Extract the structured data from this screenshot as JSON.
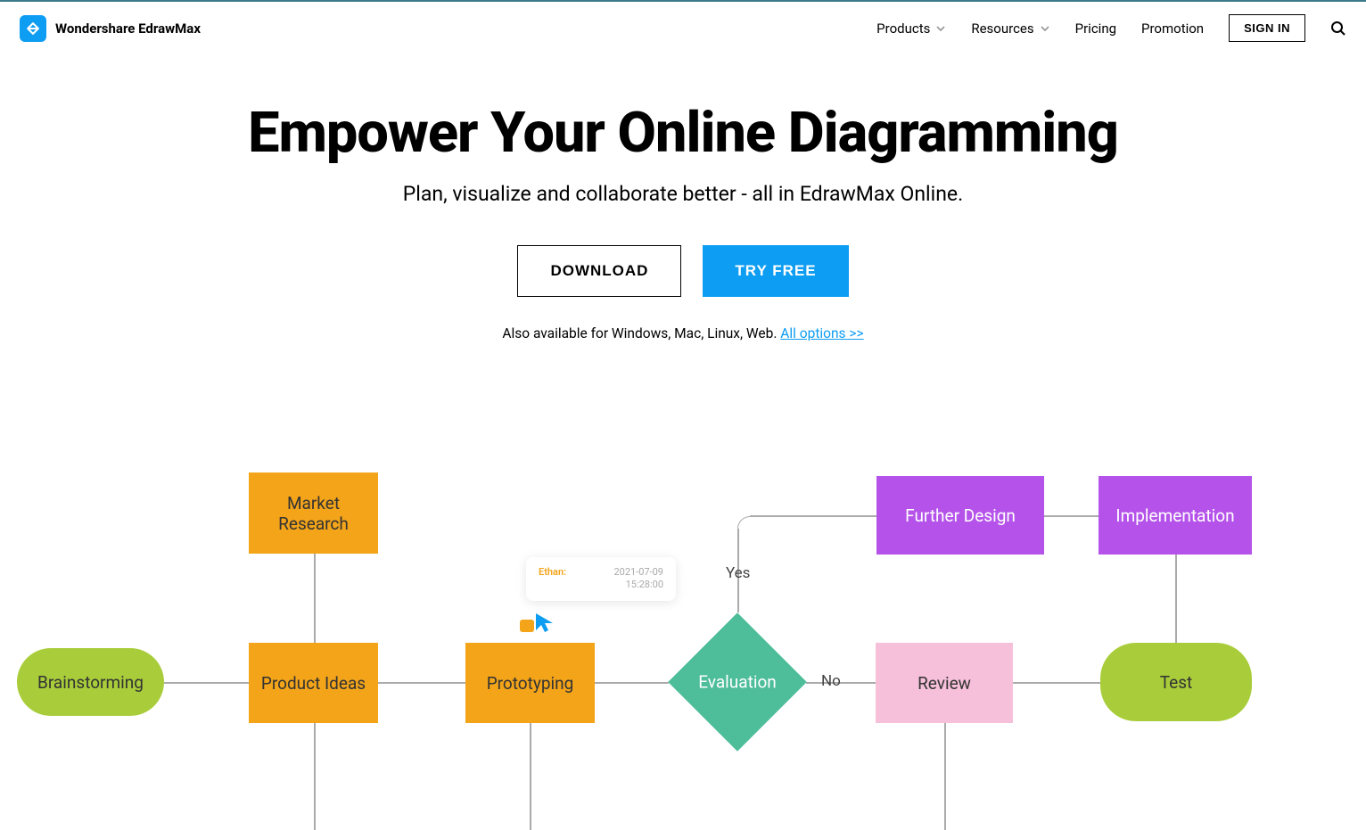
{
  "header": {
    "brand": "Wondershare EdrawMax",
    "nav": {
      "products": "Products",
      "resources": "Resources",
      "pricing": "Pricing",
      "promotion": "Promotion",
      "signin": "SIGN IN"
    }
  },
  "hero": {
    "title": "Empower Your Online Diagramming",
    "subtitle": "Plan, visualize and collaborate better - all in EdrawMax Online.",
    "download_btn": "DOWNLOAD",
    "tryfree_btn": "TRY FREE",
    "avail_prefix": "Also available for Windows, Mac, Linux, Web. ",
    "avail_link": "All options >>"
  },
  "diagram": {
    "nodes": {
      "brainstorming": "Brainstorming",
      "market_research": "Market\nResearch",
      "product_ideas": "Product Ideas",
      "prototyping": "Prototyping",
      "evaluation": "Evaluation",
      "yes": "Yes",
      "no": "No",
      "further_design": "Further Design",
      "review": "Review",
      "implementation": "Implementation",
      "test": "Test"
    },
    "comment": {
      "name": "Ethan:",
      "date": "2021-07-09",
      "time": "15:28:00"
    }
  },
  "colors": {
    "accent": "#0d9df2",
    "orange": "#f3a419",
    "green": "#a9cd3a",
    "purple": "#b552ea",
    "pink": "#f7c0da",
    "teal": "#4ebd99"
  }
}
